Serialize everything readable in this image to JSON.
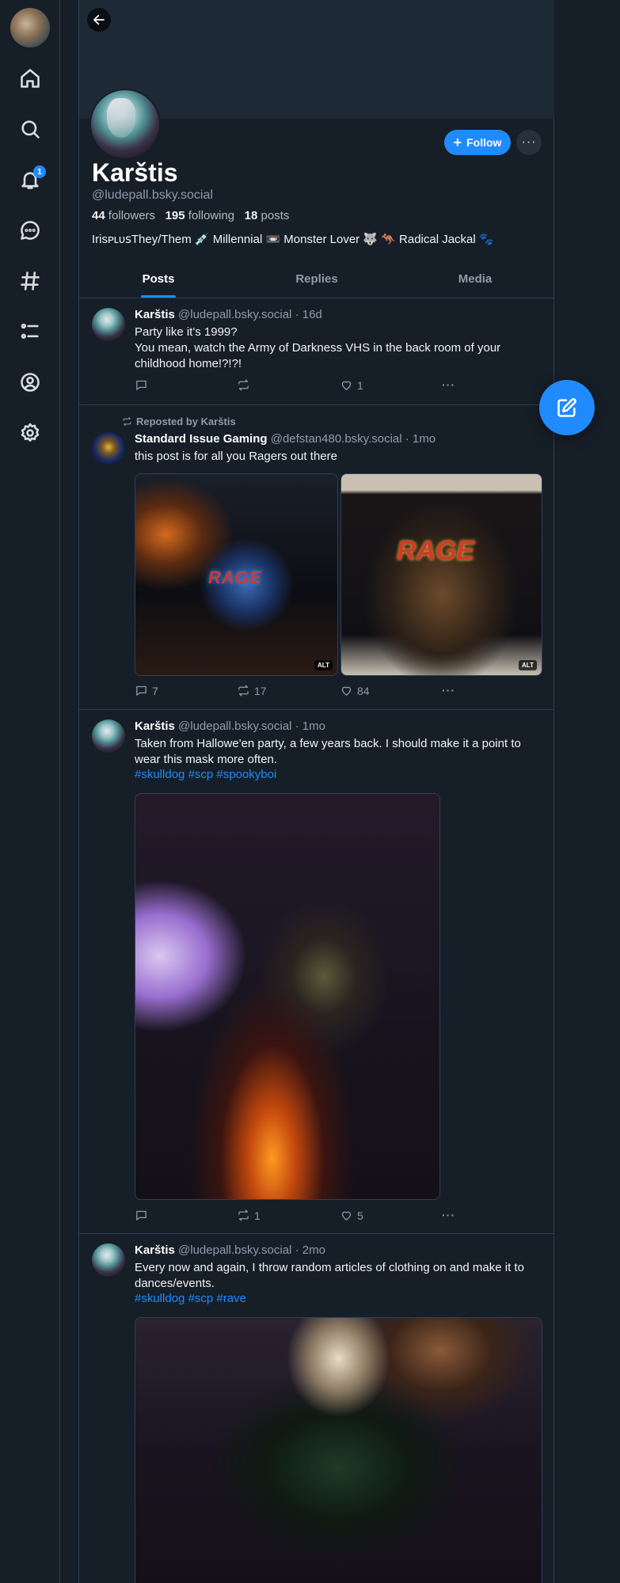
{
  "nav": {
    "items": [
      {
        "icon": "home-icon"
      },
      {
        "icon": "search-icon"
      },
      {
        "icon": "bell-icon",
        "badge": "1"
      },
      {
        "icon": "chat-icon"
      },
      {
        "icon": "hashtag-icon"
      },
      {
        "icon": "list-icon"
      },
      {
        "icon": "profile-icon"
      },
      {
        "icon": "gear-icon"
      }
    ]
  },
  "profile": {
    "display_name": "Karštis",
    "handle": "@ludepall.bsky.social",
    "followers_count": "44",
    "followers_label": "followers",
    "following_count": "195",
    "following_label": "following",
    "posts_count": "18",
    "posts_label": "posts",
    "bio": "IrisᴘʟᴜꜱThey/Them 💉 Millennial 📼 Monster Lover 🐺 🦘 Radical Jackal 🐾",
    "follow_label": "Follow",
    "more_label": "···"
  },
  "tabs": [
    "Posts",
    "Replies",
    "Media"
  ],
  "accent_color": "#208bfe",
  "posts": [
    {
      "author": "Karštis",
      "handle": "@ludepall.bsky.social",
      "time": "· 16d",
      "text": "Party like it's 1999?\nYou mean, watch the Army of Darkness VHS in the back room of your childhood home!?!?!",
      "replies": "",
      "reposts": "",
      "likes": "1"
    },
    {
      "repost_label": "Reposted by Karštis",
      "author": "Standard Issue Gaming",
      "handle": "@defstan480.bsky.social",
      "time": "· 1mo",
      "text": "this post is for all you Ragers out there",
      "images": [
        {
          "alt_badge": "ALT"
        },
        {
          "alt_badge": "ALT"
        }
      ],
      "replies": "7",
      "reposts": "17",
      "likes": "84"
    },
    {
      "author": "Karštis",
      "handle": "@ludepall.bsky.social",
      "time": "· 1mo",
      "text": "Taken from Hallowe'en party, a few years back. I should make it a point to wear this mask more often.",
      "tags": [
        "#skulldog",
        "#scp",
        "#spookyboi"
      ],
      "replies": "",
      "reposts": "1",
      "likes": "5"
    },
    {
      "author": "Karštis",
      "handle": "@ludepall.bsky.social",
      "time": "· 2mo",
      "text": "Every now and again, I throw random articles of clothing on and make it to dances/events.",
      "tags": [
        "#skulldog",
        "#scp",
        "#rave"
      ]
    }
  ]
}
